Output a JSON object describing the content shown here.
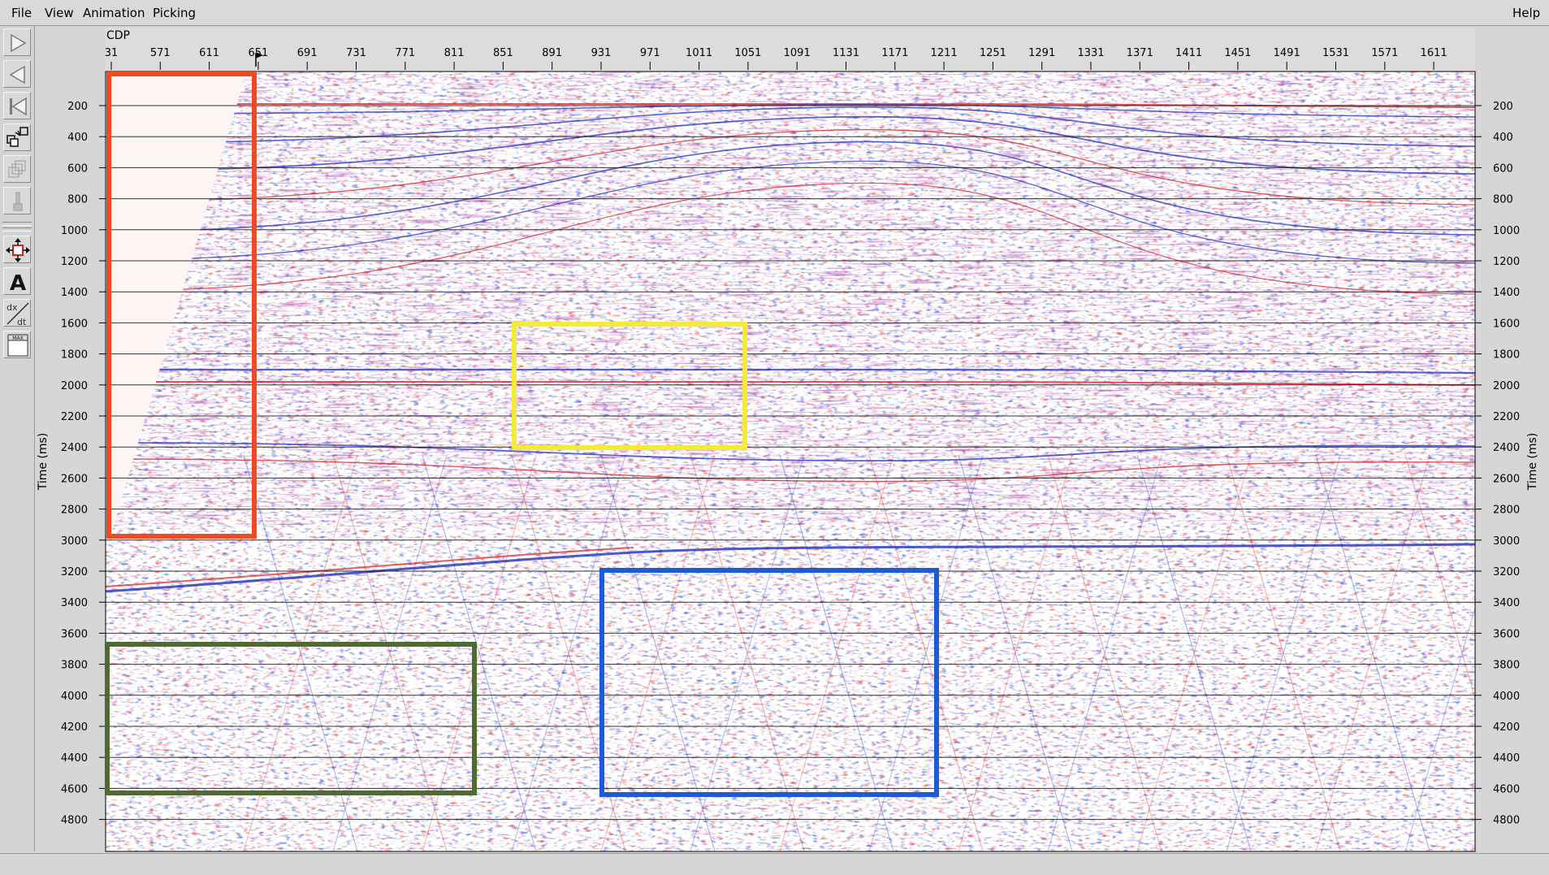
{
  "menu": {
    "file": "File",
    "view": "View",
    "animation": "Animation",
    "picking": "Picking",
    "help": "Help"
  },
  "toolbar": {
    "icons": [
      "play-forward-icon",
      "play-backward-icon",
      "rewind-to-start-icon",
      "panel-swap-icon",
      "stacked-panels-icon",
      "brush-icon",
      "pan-arrows-icon",
      "text-annotation-icon",
      "dx-dt-icon",
      "max-window-icon"
    ]
  },
  "axes": {
    "top_title": "CDP",
    "top_ticks": [
      "31",
      "571",
      "611",
      "651",
      "691",
      "731",
      "771",
      "811",
      "851",
      "891",
      "931",
      "971",
      "1011",
      "1051",
      "1091",
      "1131",
      "1171",
      "1211",
      "1251",
      "1291",
      "1331",
      "1371",
      "1411",
      "1451",
      "1491",
      "1531",
      "1571",
      "1611"
    ],
    "time_label": "Time (ms)",
    "time_ticks": [
      "200",
      "400",
      "600",
      "800",
      "1000",
      "1200",
      "1400",
      "1600",
      "1800",
      "2000",
      "2200",
      "2400",
      "2600",
      "2800",
      "3000",
      "3200",
      "3400",
      "3600",
      "3800",
      "4000",
      "4200",
      "4400",
      "4600",
      "4800"
    ]
  },
  "colors": {
    "positive": "#d42020",
    "negative": "#2030c0",
    "box_red": "#f04a22",
    "box_yellow": "#f4ea3a",
    "box_green": "#4f6b32",
    "box_blue": "#1a5bd6"
  }
}
